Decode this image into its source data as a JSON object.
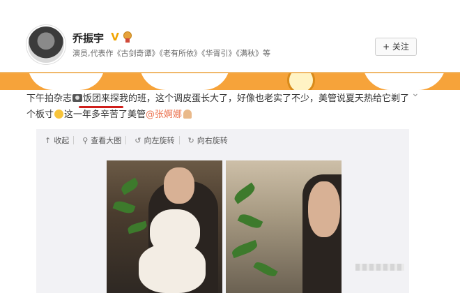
{
  "header": {
    "username": "乔振宇",
    "verified_badge": "V",
    "subtitle": "演员,代表作《古剑奇谭》《老有所依》《华胥引》《满秋》等",
    "follow_button": "+ 关注"
  },
  "post": {
    "text_part1": "下午拍杂志",
    "text_part2": "饭团来探我的班，这个调皮蛋长大了，好像也老实了不少，美管说夏天热给它剃了个板寸",
    "text_part3": "这一年多辛苦了美管",
    "mention": "@张婀娜"
  },
  "toolbar": {
    "collapse": "收起",
    "view_large": "查看大图",
    "rotate_left": "向左旋转",
    "rotate_right": "向右旋转"
  },
  "colors": {
    "band": "#f6a33a",
    "mention": "#eb7350",
    "annotation_underline": "#d0201c"
  }
}
